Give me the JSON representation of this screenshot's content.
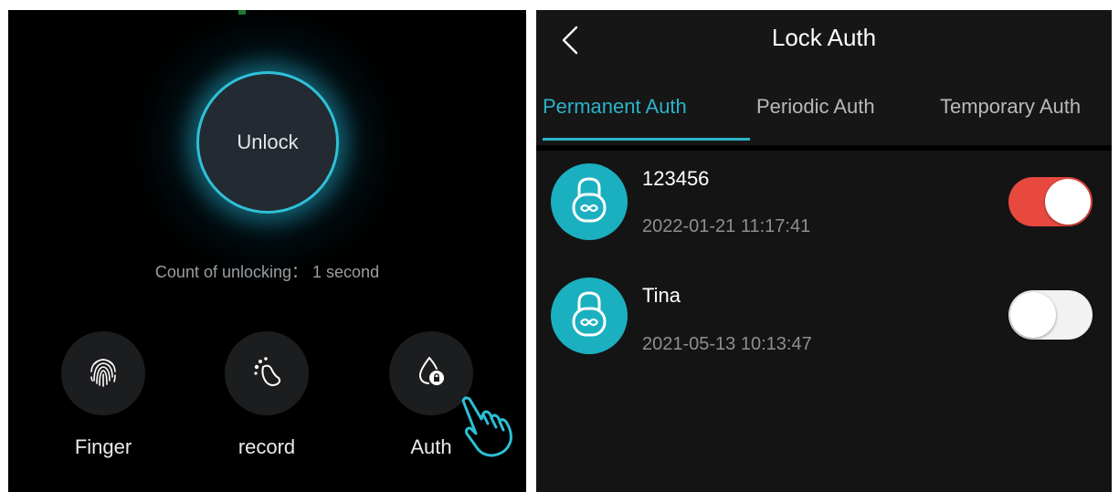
{
  "left": {
    "unlock_label": "Unlock",
    "count_text": "Count of unlocking： 1 second",
    "actions": [
      {
        "label": "Finger",
        "icon": "fingerprint-icon"
      },
      {
        "label": "record",
        "icon": "footprint-icon"
      },
      {
        "label": "Auth",
        "icon": "water-lock-icon"
      }
    ],
    "accent_color": "#2fc0d8"
  },
  "right": {
    "title": "Lock Auth",
    "tabs": [
      {
        "label": "Permanent Auth",
        "active": true
      },
      {
        "label": "Periodic Auth",
        "active": false
      },
      {
        "label": "Temporary Auth",
        "active": false
      }
    ],
    "items": [
      {
        "name": "123456",
        "date": "2022-01-21 11:17:41",
        "enabled": true
      },
      {
        "name": "Tina",
        "date": "2021-05-13 10:13:47",
        "enabled": false
      }
    ],
    "tab_active_color": "#2bb3c8",
    "toggle_on_color": "#e8493e",
    "avatar_color": "#1bb0c0"
  }
}
